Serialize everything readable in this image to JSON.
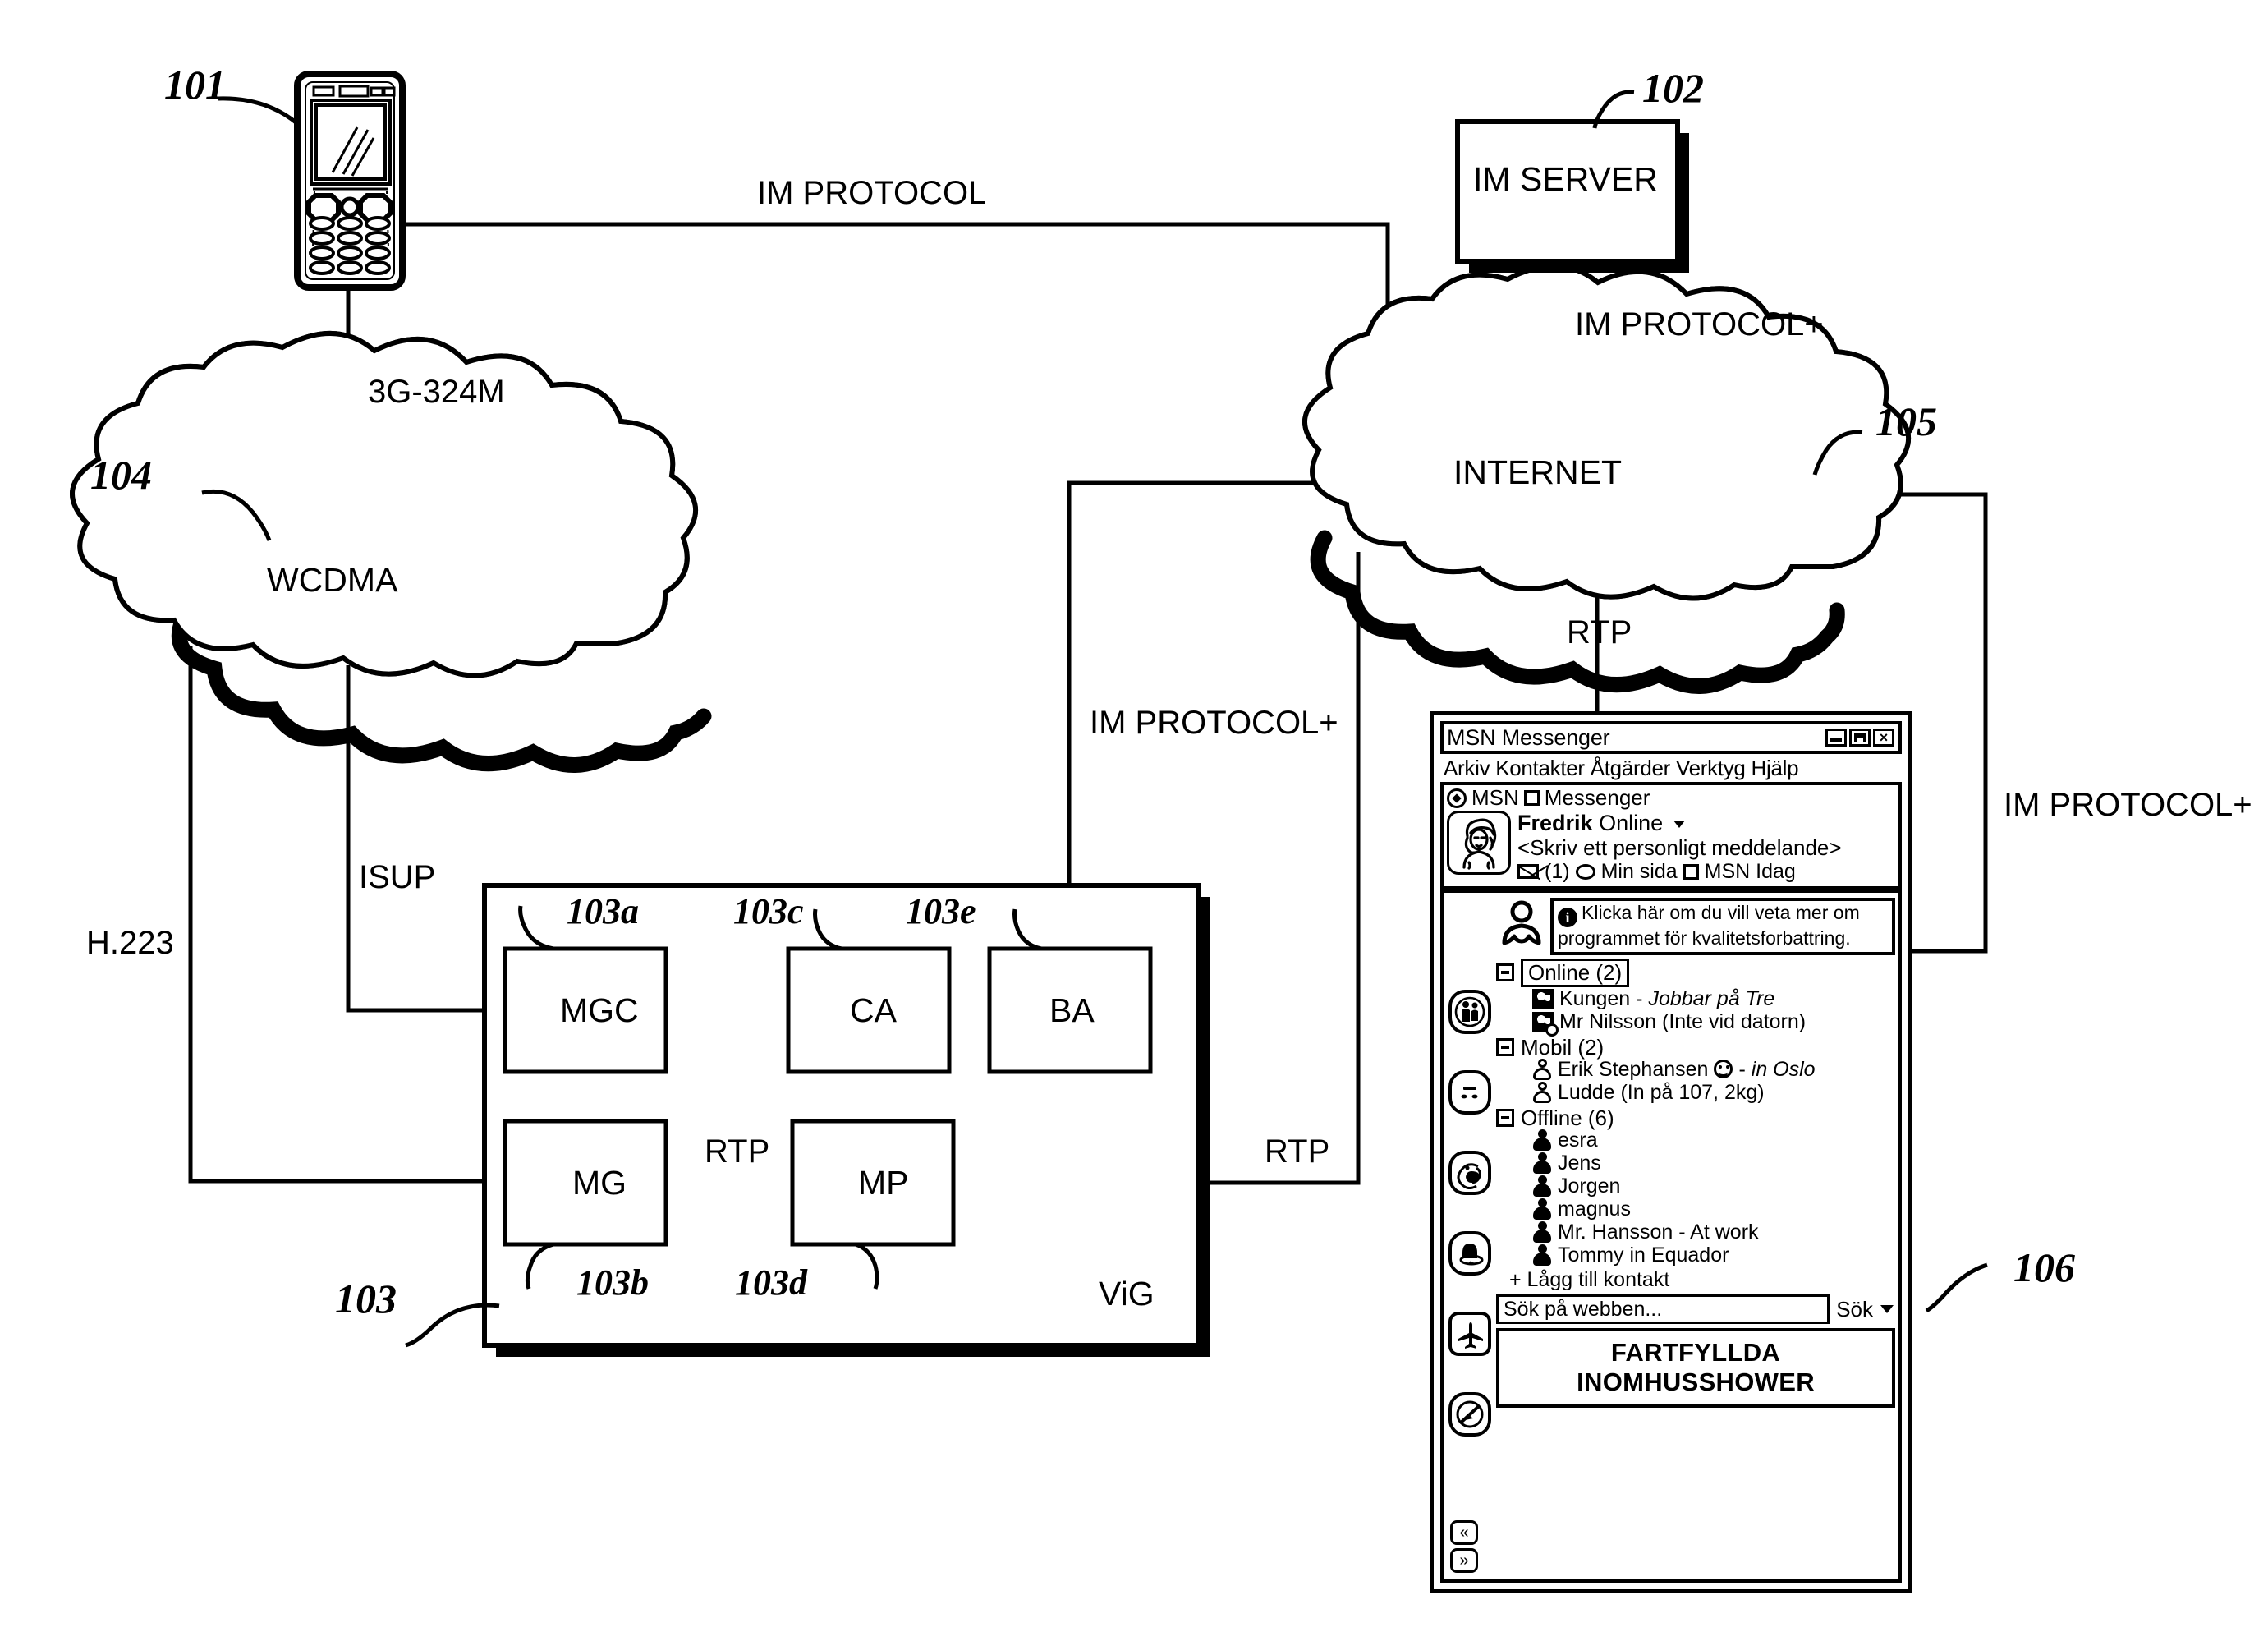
{
  "figure": {
    "nodes": {
      "mobile_phone": {
        "ref": "101"
      },
      "im_server": {
        "label": "IM SERVER",
        "ref": "102"
      },
      "vig": {
        "label": "ViG",
        "ref": "103"
      },
      "wcdma": {
        "label": "WCDMA",
        "ref": "104"
      },
      "internet": {
        "label": "INTERNET",
        "ref": "105"
      },
      "msn_client": {
        "ref": "106"
      }
    },
    "vig_blocks": [
      {
        "label": "MGC",
        "ref": "103a"
      },
      {
        "label": "MG",
        "ref": "103b"
      },
      {
        "label": "CA",
        "ref": "103c"
      },
      {
        "label": "MP",
        "ref": "103d"
      },
      {
        "label": "BA",
        "ref": "103e"
      }
    ],
    "link_labels": {
      "im_protocol": "IM PROTOCOL",
      "im_protocol_plus_server": "IM PROTOCOL+",
      "im_protocol_plus_vig": "IM PROTOCOL+",
      "im_protocol_plus_client": "IM PROTOCOL+",
      "g3_324m": "3G-324M",
      "isup": "ISUP",
      "h223": "H.223",
      "rtp_internet": "RTP",
      "rtp_inner": "RTP",
      "rtp_vig_out": "RTP"
    }
  },
  "msn": {
    "titlebar": {
      "title": "MSN Messenger",
      "minimize": "minimize-icon",
      "maximize": "maximize-icon",
      "close": "×"
    },
    "menubar": "Arkiv Kontakter Åtgärder Verktyg Hjälp",
    "brand": {
      "prefix": "MSN",
      "suffix": "Messenger"
    },
    "identity": {
      "name": "Fredrik",
      "status": "Online",
      "personal_message": "<Skriv ett personligt meddelande>",
      "mail_count": "(1)",
      "min_sida": "Min sida",
      "msn_idag": "MSN Idag"
    },
    "notice": "Klicka här om du vill veta mer om programmet för kvalitetsforbattring.",
    "groups": [
      {
        "label": "Online (2)",
        "boxed": true,
        "icon": "contact-duo-icon",
        "contacts": [
          {
            "name": "Kungen - ",
            "status": "Jobbar på Tre",
            "icon": "contact-duo-icon"
          },
          {
            "name": "Mr Nilsson (Inte vid datorn)",
            "status": "",
            "icon": "contact-duo-away-icon"
          }
        ]
      },
      {
        "label": "Mobil (2)",
        "boxed": false,
        "icon": "contact-mobile-icon",
        "contacts": [
          {
            "name": "Erik Stephansen",
            "status": "in Oslo",
            "icon": "contact-mobile-icon",
            "smiley": true,
            "dash": "- "
          },
          {
            "name": "Ludde (In på 107, 2kg)",
            "status": "",
            "icon": "contact-mobile-icon"
          }
        ]
      },
      {
        "label": "Offline (6)",
        "boxed": false,
        "icon": "contact-offline-icon",
        "contacts": [
          {
            "name": "esra",
            "status": "",
            "icon": "contact-offline-icon"
          },
          {
            "name": "Jens",
            "status": "",
            "icon": "contact-offline-icon"
          },
          {
            "name": "Jorgen",
            "status": "",
            "icon": "contact-offline-icon"
          },
          {
            "name": "magnus",
            "status": "",
            "icon": "contact-offline-icon"
          },
          {
            "name": "Mr. Hansson - At work",
            "status": "",
            "icon": "contact-offline-icon"
          },
          {
            "name": "Tommy in Equador",
            "status": "",
            "icon": "contact-offline-icon"
          }
        ]
      }
    ],
    "add_contact": "+ Lågg till kontakt",
    "search": {
      "placeholder": "Sök på webben...",
      "button": "Sök"
    },
    "ad": {
      "line1": "FARTFYLLDA",
      "line2": "INOMHUSSHOWER"
    },
    "sidebar_icons": [
      "people-couple-icon",
      "face-icon",
      "creature-icon",
      "bell-icon",
      "airplane-icon",
      "no-entry-icon"
    ],
    "scroll": {
      "up": "«",
      "down": "»"
    }
  },
  "colors": {
    "ink": "#000000",
    "paper": "#ffffff"
  }
}
